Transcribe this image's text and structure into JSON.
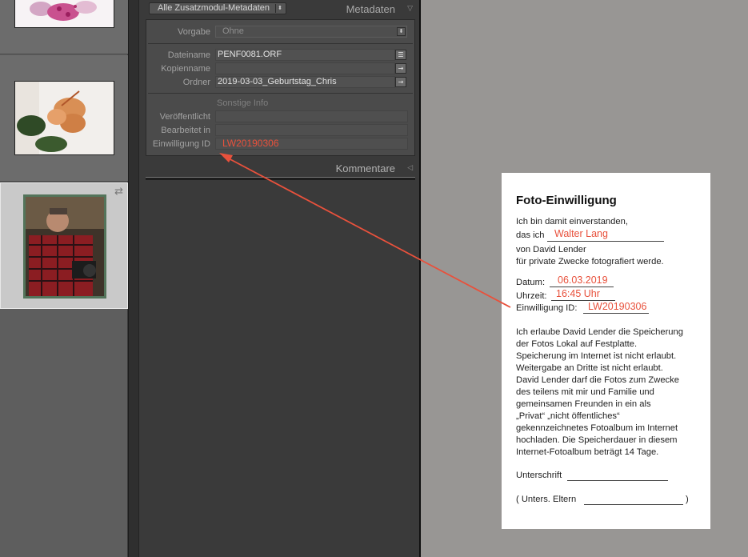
{
  "metadata_panel": {
    "preset_select": "Alle Zusatzmodul-Metadaten",
    "title": "Metadaten",
    "vorgabe": {
      "label": "Vorgabe",
      "value": "Ohne"
    },
    "fields": [
      {
        "label": "Dateiname",
        "value": "PENF0081.ORF"
      },
      {
        "label": "Kopienname",
        "value": ""
      },
      {
        "label": "Ordner",
        "value": "2019-03-03_Geburtstag_Chris"
      }
    ],
    "section_title": "Sonstige Info",
    "other_fields": [
      {
        "label": "Veröffentlicht",
        "value": ""
      },
      {
        "label": "Bearbeitet in",
        "value": ""
      },
      {
        "label": "Einwilligung ID",
        "value": "LW20190306"
      }
    ],
    "comments_title": "Kommentare"
  },
  "consent_form": {
    "title": "Foto-Einwilligung",
    "intro_1": "Ich bin damit einverstanden,",
    "intro_2": "das ich",
    "name": "Walter Lang",
    "by_line": "von  David Lender",
    "purpose": "für private Zwecke fotografiert werde.",
    "date_label": "Datum:",
    "date": "06.03.2019",
    "time_label": "Uhrzeit:",
    "time": "16:45 Uhr",
    "id_label": "Einwilligung ID:",
    "id": "LW20190306",
    "terms": [
      "Ich erlaube David Lender die Speicherung",
      "der Fotos Lokal auf Festplatte.",
      "Speicherung im Internet ist nicht erlaubt.",
      "Weitergabe an Dritte ist nicht erlaubt.",
      "David Lender darf die Fotos zum Zwecke",
      "des teilens mit mir und Familie und",
      "gemeinsamen Freunden in ein als",
      "„Privat“  „nicht öffentliches“",
      "gekennzeichnetes  Fotoalbum im Internet",
      "hochladen. Die Speicherdauer in diesem",
      "Internet-Fotoalbum beträgt 14 Tage."
    ],
    "signature_label": "Unterschrift",
    "parents_label_open": "( Unters. Eltern",
    "parents_label_close": ")"
  },
  "filmstrip": {
    "items": [
      {
        "subject": "pink orchid flowers"
      },
      {
        "subject": "orange hibiscus flower"
      },
      {
        "subject": "man in red plaid shirt holding camera",
        "selected": true
      }
    ]
  },
  "colors": {
    "annotation_red": "#e8513c",
    "panel_bg": "#3a3a3a",
    "workspace_bg": "#989694"
  }
}
